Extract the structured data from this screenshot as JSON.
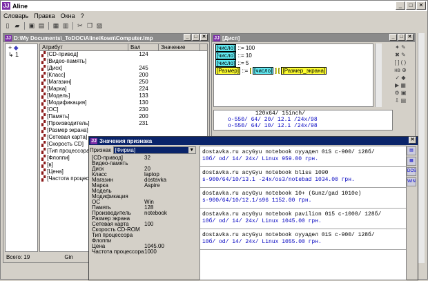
{
  "app": {
    "title": "Aline",
    "icon": "JJ"
  },
  "menu": [
    "Словарь",
    "Правка",
    "Окна",
    "?"
  ],
  "toolbar_icons": [
    "new-icon",
    "open-icon",
    "save-icon",
    "print-icon",
    "table-icon",
    "grid-icon",
    "cut-icon",
    "copy-icon",
    "paste-icon"
  ],
  "left_window": {
    "title": "D:\\My Documents\\_ToDOC\\Aline\\Комп\\Computer.lmp",
    "tree": [
      "+",
      "1"
    ],
    "columns": [
      "Атрибут",
      "Вал",
      "Значение"
    ],
    "rows": [
      {
        "name": "[CD-привод]",
        "val": "124"
      },
      {
        "name": "[Видео-память]",
        "val": ""
      },
      {
        "name": "[Диск]",
        "val": "245"
      },
      {
        "name": "[Класс]",
        "val": "200"
      },
      {
        "name": "[Магазин]",
        "val": "250"
      },
      {
        "name": "[Марка]",
        "val": "224"
      },
      {
        "name": "[Модель]",
        "val": "133"
      },
      {
        "name": "[Модификация]",
        "val": "130"
      },
      {
        "name": "[ОС]",
        "val": "230"
      },
      {
        "name": "[Память]",
        "val": "200"
      },
      {
        "name": "[Производитель]",
        "val": "231"
      },
      {
        "name": "[Размер экрана]",
        "val": ""
      },
      {
        "name": "[Сетевая карта]",
        "val": ""
      },
      {
        "name": "[Скорость CD]",
        "val": ""
      },
      {
        "name": "[Тип процессора]",
        "val": ""
      },
      {
        "name": "[Флоппи]",
        "val": ""
      },
      {
        "name": "[в]",
        "val": ""
      },
      {
        "name": "[Цена]",
        "val": ""
      },
      {
        "name": "[Частота процессора]",
        "val": ""
      }
    ],
    "status": [
      "Всего: 19",
      "Gin"
    ]
  },
  "right_window": {
    "title": "[Дисп]",
    "lines": [
      {
        "tag": "[число]",
        "sep": "::=",
        "val": "100"
      },
      {
        "tag": "[число]",
        "sep": "::=",
        "val": "10"
      },
      {
        "tag": "[число]",
        "sep": "::=",
        "val": "5"
      }
    ],
    "rule": {
      "a": "[Размер]",
      "b": "::=",
      "c": "[",
      "d": "[число]",
      "e": "]",
      "f": "[",
      "g": "[Размер_экрана]"
    },
    "code": [
      "120x64/ 15inch/",
      "о-550/ 64/ 20/ 12.1 /24x/98",
      "о-550/ 64/ 10/ 12.1 /24x/98"
    ]
  },
  "dialog": {
    "title": "Значения признака",
    "selector_label": "Признак",
    "selector_value": "[Фирма]",
    "props": [
      [
        "[CD-привод]",
        "32"
      ],
      [
        "Видео-память",
        ""
      ],
      [
        "Диск",
        "20"
      ],
      [
        "Класс",
        "laptop"
      ],
      [
        "Магазин",
        "dostavka"
      ],
      [
        "Марка",
        "Aspire"
      ],
      [
        "Модель",
        ""
      ],
      [
        "Модификация",
        ""
      ],
      [
        "ОС",
        "Win"
      ],
      [
        "Память",
        "128"
      ],
      [
        "Производитель",
        "notebook"
      ],
      [
        "Размер экрана",
        ""
      ],
      [
        "Сетевая карта",
        "100"
      ],
      [
        "Скорость CD-ROM",
        ""
      ],
      [
        "Тип процессора",
        ""
      ],
      [
        "Флоппи",
        ""
      ],
      [
        "Цена",
        "1045.00"
      ],
      [
        "Частота процессора",
        "1000"
      ]
    ],
    "records": [
      [
        "dostavka.ru acyGyu notebook oуyaдeл 01S c-900/ 128б/",
        "10б/ od/ 14/ 24x/ Linux 959.00 грн."
      ],
      [
        "dostavka.ru acyGyu notebook bliss 1090",
        "s-900/64/10/13.1 -24x/os3/notebad 1034.00 грн."
      ],
      [
        "dostavka.ru acyGyu notebook 10+ (Gunz/gad 1010e)",
        "s-900/64/10/12.1/s96 1152.00 грн."
      ],
      [
        "dostavka.ru acyGyu notebook pavilion 015 c-1000/ 128б/",
        "10б/ od/ 14/ 24x/ Linux 1045.00 грн."
      ],
      [
        "dostavka.ru acyGyu notebook oуyaдeл 01S c-900/ 128б/",
        "10б/ od/ 14/ 24x/ Linux 1055.00 грн."
      ]
    ],
    "side_icons": [
      "new-icon",
      "save-icon",
      "dos-icon",
      "win-icon"
    ]
  }
}
